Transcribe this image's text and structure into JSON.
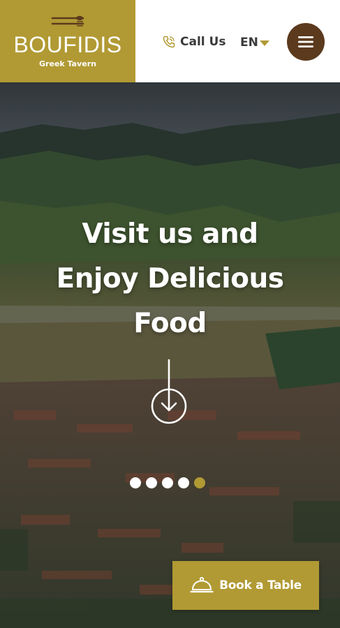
{
  "header": {
    "logo": {
      "name": "BOUFIDIS",
      "subtitle": "Greek Tavern",
      "icon": "cutlery-icon"
    },
    "call_us": {
      "label": "Call Us",
      "icon": "phone-icon"
    },
    "language": {
      "label": "EN",
      "icon": "caret-down-icon"
    },
    "menu": {
      "icon": "hamburger-menu-icon"
    }
  },
  "hero": {
    "title_lines": [
      "Visit us and",
      "Enjoy Delicious",
      "Food"
    ],
    "scroll_icon": "arrow-down-circle-icon",
    "slider": {
      "total_slides": 5,
      "active_slide": 5
    },
    "cta": {
      "label": "Book a Table",
      "icon": "cloche-icon"
    }
  },
  "colors": {
    "brand_gold": "#b19a34",
    "menu_brown": "#5b3a1e",
    "header_bg": "#ffffff",
    "text_dark": "#3a3a3a",
    "white": "#ffffff"
  }
}
